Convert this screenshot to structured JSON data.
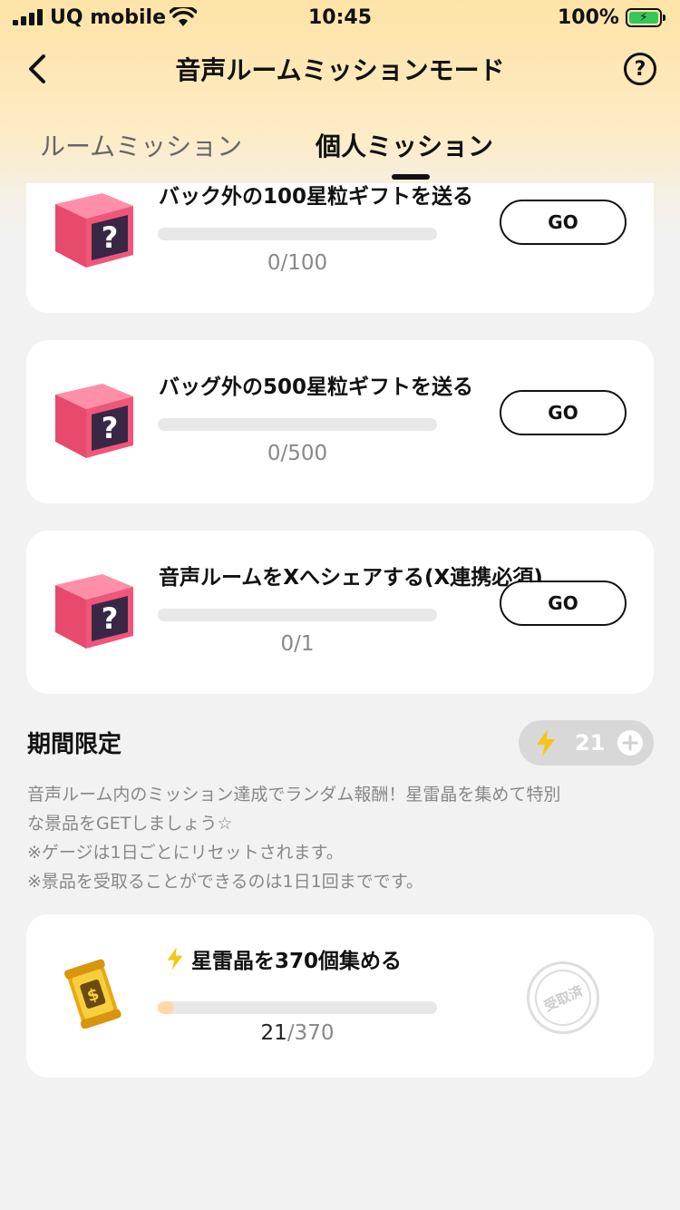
{
  "status_bar": {
    "carrier": "UQ mobile",
    "time": "10:45",
    "battery": "100%"
  },
  "nav": {
    "title": "音声ルームミッションモード",
    "help": "?"
  },
  "tabs": [
    {
      "label": "ルームミッション",
      "active": false
    },
    {
      "label": "個人ミッション",
      "active": true
    }
  ],
  "missions": [
    {
      "title": "バック外の100星粒ギフトを送る",
      "progress": "0/100",
      "progress_fraction": 0,
      "button": "GO",
      "icon": "mystery-box-icon"
    },
    {
      "title": "バッグ外の500星粒ギフトを送る",
      "progress": "0/500",
      "progress_fraction": 0,
      "button": "GO",
      "icon": "mystery-box-icon"
    },
    {
      "title": "音声ルームをXへシェアする(X連携必須)",
      "progress": "0/1",
      "progress_fraction": 0,
      "button": "GO",
      "icon": "mystery-box-icon"
    }
  ],
  "limited": {
    "title": "期間限定",
    "energy_count": "21",
    "description": [
      "音声ルーム内のミッション達成でランダム報酬！星雷晶を集めて特別",
      "な景品をGETしましょう☆",
      "※ゲージは1日ごとにリセットされます。",
      "※景品を受取ることができるのは1日1回までです。"
    ],
    "reward": {
      "title": "星雷晶を370個集める",
      "current": "21",
      "total": "/370",
      "progress_fraction": 0.057,
      "stamp": "受取済",
      "icon": "coin-jar-icon"
    }
  },
  "colors": {
    "accent_pink": "#f0557a",
    "box_dark": "#3a2746",
    "bolt": "#f5c518",
    "progress_fill": "#ffd9a8"
  }
}
